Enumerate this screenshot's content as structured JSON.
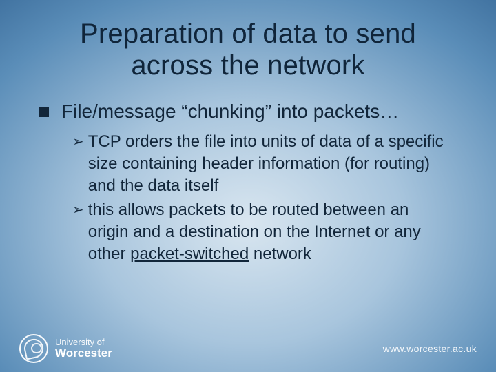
{
  "title_line1": "Preparation of data to send",
  "title_line2": "across the network",
  "bullet1": "File/message “chunking” into packets…",
  "sub1": "TCP orders the file into units of data of a specific size containing header information (for routing) and the data itself",
  "sub2_pre": "this allows packets to be routed between an origin and a destination on the Internet or any other ",
  "sub2_underlined": "packet-switched",
  "sub2_post": " network",
  "logo_line1": "University of",
  "logo_line2": "Worcester",
  "footer_url": "www.worcester.ac.uk"
}
